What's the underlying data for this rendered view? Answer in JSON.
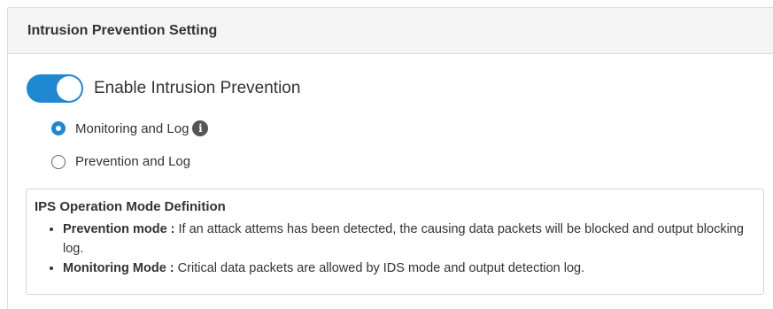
{
  "panel": {
    "title": "Intrusion Prevention Setting"
  },
  "toggle": {
    "label": "Enable Intrusion Prevention",
    "enabled": true,
    "color": "#1e88d2"
  },
  "modes": [
    {
      "label": "Monitoring and Log",
      "selected": true,
      "icon": "info-icon"
    },
    {
      "label": "Prevention and Log",
      "selected": false
    }
  ],
  "definition": {
    "title": "IPS Operation Mode Definition",
    "items": [
      {
        "term": "Prevention mode :",
        "text": " If an attack attems has been detected, the causing data packets will be blocked and output blocking log."
      },
      {
        "term": "Monitoring Mode :",
        "text": " Critical data packets are allowed by IDS mode and output detection log."
      }
    ]
  }
}
